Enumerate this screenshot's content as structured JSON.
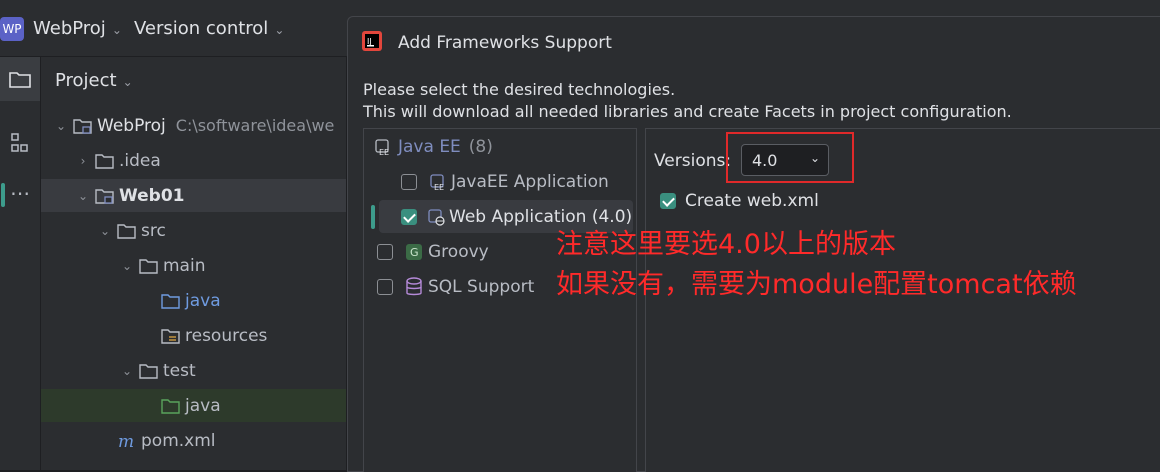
{
  "topbar": {
    "project_badge": "WP",
    "project_name": "WebProj",
    "vcs_label": "Version control"
  },
  "project_panel": {
    "title": "Project",
    "tree": [
      {
        "label": "WebProj",
        "suffix": "C:\\software\\idea\\we",
        "indent": 0,
        "arrow": "down",
        "icon": "module-folder-icon"
      },
      {
        "label": ".idea",
        "indent": 1,
        "arrow": "right",
        "icon": "folder-icon"
      },
      {
        "label": "Web01",
        "indent": 1,
        "arrow": "down",
        "icon": "module-folder-icon",
        "selected": true
      },
      {
        "label": "src",
        "indent": 2,
        "arrow": "down",
        "icon": "folder-icon"
      },
      {
        "label": "main",
        "indent": 3,
        "arrow": "down",
        "icon": "folder-icon"
      },
      {
        "label": "java",
        "indent": 4,
        "arrow": "",
        "icon": "source-folder-icon"
      },
      {
        "label": "resources",
        "indent": 4,
        "arrow": "",
        "icon": "resources-folder-icon"
      },
      {
        "label": "test",
        "indent": 3,
        "arrow": "down",
        "icon": "folder-icon"
      },
      {
        "label": "java",
        "indent": 4,
        "arrow": "",
        "icon": "test-folder-icon",
        "green": true
      },
      {
        "label": "pom.xml",
        "indent": 2,
        "arrow": "",
        "icon": "maven-icon"
      }
    ]
  },
  "dialog": {
    "title": "Add Frameworks Support",
    "desc_line1": "Please select the desired technologies.",
    "desc_line2": "This will download all needed libraries and create Facets in project configuration.",
    "frameworks": {
      "group_label": "Java EE",
      "group_count": "(8)",
      "items": [
        {
          "label": "JavaEE Application",
          "checked": false
        },
        {
          "label": "Web Application (4.0)",
          "checked": true
        }
      ],
      "others": [
        {
          "label": "Groovy",
          "checked": false
        },
        {
          "label": "SQL Support",
          "checked": false
        }
      ]
    },
    "options": {
      "versions_label": "Versions:",
      "version_value": "4.0",
      "create_webxml_label": "Create web.xml",
      "create_webxml_checked": true
    }
  },
  "annotation": {
    "line1": "注意这里要选4.0以上的版本",
    "line2": "如果没有，需要为module配置tomcat依赖",
    "color": "#ff2a2a"
  }
}
